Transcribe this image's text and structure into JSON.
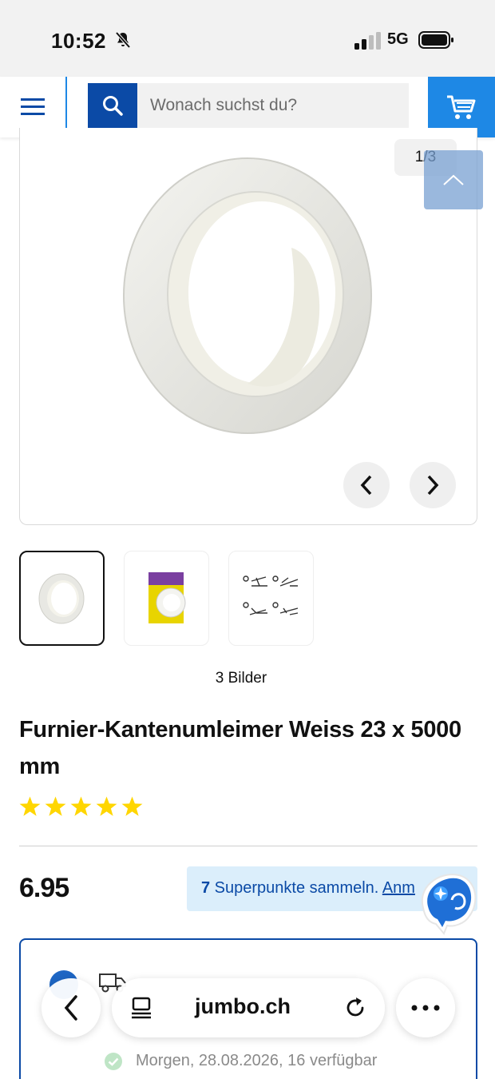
{
  "status_bar": {
    "time": "10:52",
    "network": "5G",
    "icons": [
      "bell-slash-icon",
      "signal-icon",
      "battery-icon"
    ]
  },
  "header": {
    "search_placeholder": "Wonach suchst du?",
    "icons": [
      "menu-icon",
      "search-icon",
      "cart-icon"
    ],
    "colors": {
      "primary": "#0b4aa6",
      "accent": "#1e88e5"
    }
  },
  "gallery": {
    "counter": "1/3",
    "images_count_label": "3 Bilder",
    "thumbnails": [
      "white-edge-tape-roll",
      "packaged-edge-tape",
      "instruction-diagram"
    ],
    "active_thumbnail": 1
  },
  "product": {
    "title": "Furnier-Kantenumleimer Weiss 23 x 5000 mm",
    "rating_stars": 5,
    "price": "6.95",
    "superpunkte_count": "7",
    "superpunkte_text": " Superpunkte sammeln. ",
    "superpunkte_link": "Anm"
  },
  "delivery": {
    "availability": "Morgen, 28.08.2026, 16 verfügbar"
  },
  "browser": {
    "url": "jumbo.ch"
  }
}
